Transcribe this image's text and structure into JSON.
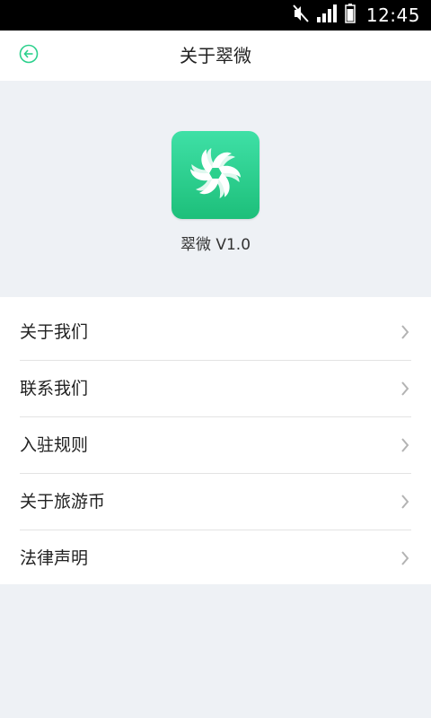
{
  "status_bar": {
    "time": "12:45",
    "icons": [
      "mute-icon",
      "signal-icon",
      "battery-icon"
    ]
  },
  "topbar": {
    "back_icon": "back-arrow-circle-icon",
    "title": "关于翠微"
  },
  "app": {
    "logo_icon": "app-logo-icon",
    "version_text": "翠微 V1.0"
  },
  "menu": {
    "items": [
      {
        "label": "关于我们"
      },
      {
        "label": "联系我们"
      },
      {
        "label": "入驻规则"
      },
      {
        "label": "关于旅游币"
      },
      {
        "label": "法律声明"
      }
    ]
  },
  "colors": {
    "accent": "#2bd08c",
    "background": "#eef1f5",
    "status_bar": "#000000"
  }
}
